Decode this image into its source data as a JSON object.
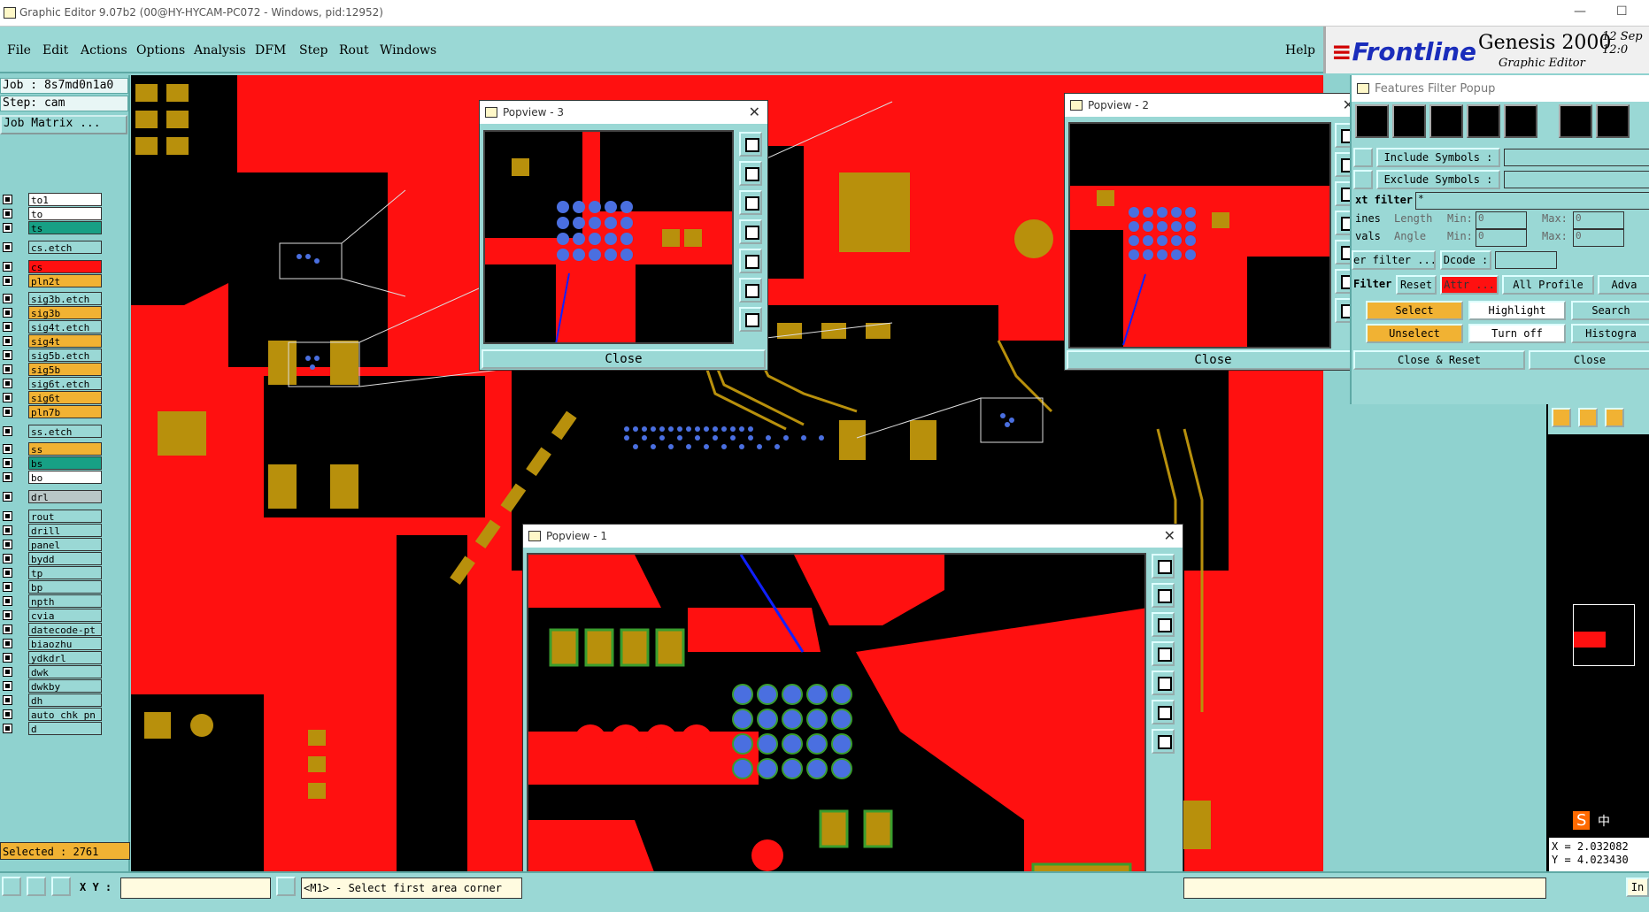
{
  "window": {
    "title": "Graphic Editor 9.07b2 (00@HY-HYCAM-PC072 - Windows, pid:12952)",
    "min": "—",
    "max": "☐",
    "close": "✕"
  },
  "menu": {
    "items": [
      "File",
      "Edit",
      "Actions",
      "Options",
      "Analysis",
      "DFM",
      "Step",
      "Rout",
      "Windows"
    ],
    "help": "Help"
  },
  "logo": {
    "frontline": "Frontline",
    "product": "Genesis 2000",
    "subtitle": "Graphic Editor",
    "date": "12 Sep",
    "time": "12:0"
  },
  "job": {
    "job_line": "Job : 8s7md0n1a0",
    "step_line": "Step: cam",
    "matrix_button": "Job Matrix ..."
  },
  "layers": [
    {
      "name": "to1",
      "color": "#ffffff"
    },
    {
      "name": "to",
      "color": "#ffffff"
    },
    {
      "name": "ts",
      "color": "#17a085"
    },
    {
      "name": "cs.etch",
      "color": "#9ad8d5"
    },
    {
      "name": "cs",
      "color": "#ff1010"
    },
    {
      "name": "pln2t",
      "color": "#f1b233"
    },
    {
      "name": "sig3b.etch",
      "color": "#9ad8d5"
    },
    {
      "name": "sig3b",
      "color": "#f1b233"
    },
    {
      "name": "sig4t.etch",
      "color": "#9ad8d5"
    },
    {
      "name": "sig4t",
      "color": "#f1b233"
    },
    {
      "name": "sig5b.etch",
      "color": "#9ad8d5"
    },
    {
      "name": "sig5b",
      "color": "#f1b233"
    },
    {
      "name": "sig6t.etch",
      "color": "#9ad8d5"
    },
    {
      "name": "sig6t",
      "color": "#f1b233"
    },
    {
      "name": "pln7b",
      "color": "#f1b233"
    },
    {
      "name": "ss.etch",
      "color": "#9ad8d5"
    },
    {
      "name": "ss",
      "color": "#f1b233"
    },
    {
      "name": "bs",
      "color": "#17a085"
    },
    {
      "name": "bo",
      "color": "#ffffff"
    },
    {
      "name": "drl",
      "color": "#b9c7c7"
    },
    {
      "name": "rout",
      "color": "#9ad8d5"
    },
    {
      "name": "drill",
      "color": "#9ad8d5"
    },
    {
      "name": "panel",
      "color": "#9ad8d5"
    },
    {
      "name": "bydd",
      "color": "#9ad8d5"
    },
    {
      "name": "tp",
      "color": "#9ad8d5"
    },
    {
      "name": "bp",
      "color": "#9ad8d5"
    },
    {
      "name": "npth",
      "color": "#9ad8d5"
    },
    {
      "name": "cvia",
      "color": "#9ad8d5"
    },
    {
      "name": "datecode-pt",
      "color": "#9ad8d5"
    },
    {
      "name": "biaozhu",
      "color": "#9ad8d5"
    },
    {
      "name": "ydkdrl",
      "color": "#9ad8d5"
    },
    {
      "name": "dwk",
      "color": "#9ad8d5"
    },
    {
      "name": "dwkby",
      "color": "#9ad8d5"
    },
    {
      "name": "dh",
      "color": "#9ad8d5"
    },
    {
      "name": "auto_chk_pn",
      "color": "#9ad8d5"
    },
    {
      "name": "d",
      "color": "#9ad8d5"
    }
  ],
  "selected": "Selected : 2761",
  "popviews": [
    {
      "title": "Popview - 3",
      "close": "Close"
    },
    {
      "title": "Popview - 2",
      "close": "Close"
    },
    {
      "title": "Popview - 1",
      "close": "Close"
    }
  ],
  "features_filter": {
    "title": "Features Filter Popup",
    "include_symbols": "Include Symbols :",
    "exclude_symbols": "Exclude Symbols :",
    "text_filter_label": "xt filter",
    "text_filter_value": "*",
    "lines_label": "ines",
    "arcs_label": "vals",
    "length_label": "Length",
    "angle_label": "Angle",
    "min_label": "Min:",
    "max_label": "Max:",
    "min_value": "0",
    "max_value": "0",
    "er_filter": "er filter ...",
    "dcode": "Dcode :",
    "filter": "Filter",
    "reset": "Reset",
    "attr": "Attr ...",
    "all_profile": "All Profile",
    "adv": "Adva",
    "select": "Select",
    "highlight": "Highlight",
    "search": "Search",
    "unselect": "Unselect",
    "turn_off": "Turn off",
    "histogram": "Histogra",
    "close_reset": "Close & Reset",
    "close": "Close"
  },
  "statusbar": {
    "xy_label": "X Y :",
    "xy_value": "",
    "prompt": "<M1> - Select first area corner",
    "ime": "中",
    "coord_x": "X = 2.032082",
    "coord_y": "Y = 4.023430",
    "right_btn": "In"
  }
}
